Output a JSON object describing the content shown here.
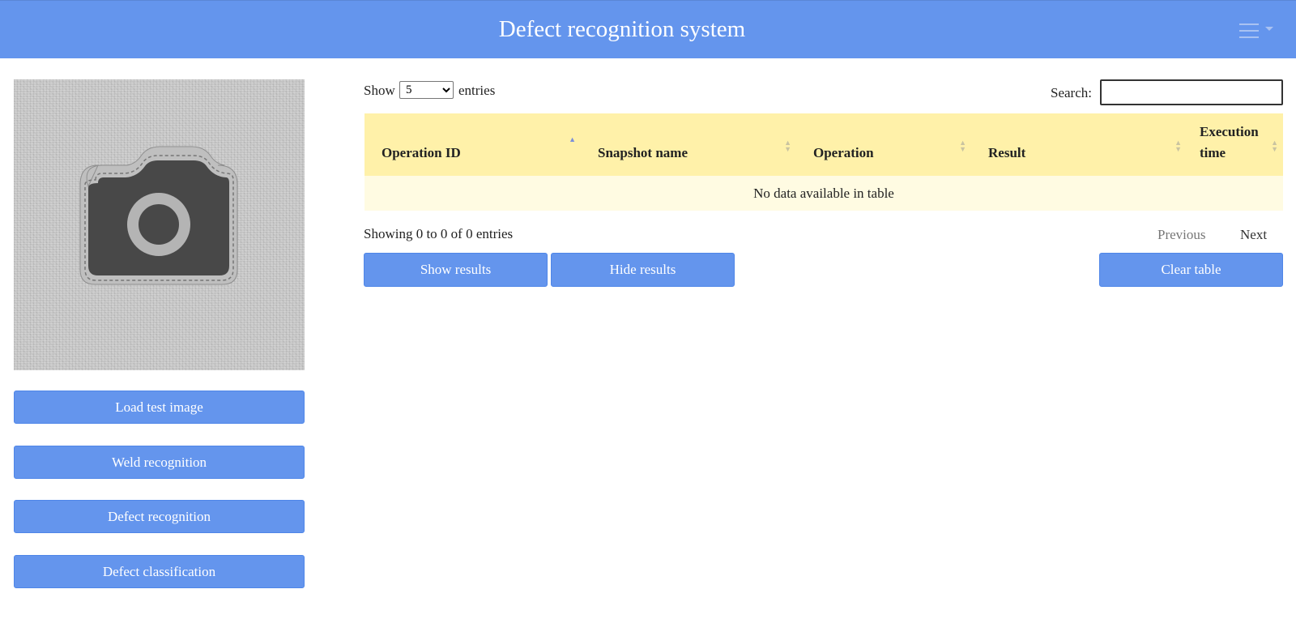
{
  "header": {
    "title": "Defect recognition system"
  },
  "snapshot": {
    "icon": "camera-icon"
  },
  "sidebar": {
    "buttons": [
      {
        "label": "Load test image"
      },
      {
        "label": "Weld recognition"
      },
      {
        "label": "Defect recognition"
      },
      {
        "label": "Defect classification"
      }
    ]
  },
  "table_controls": {
    "show_label": "Show",
    "entries_label": "entries",
    "length_selected": "5",
    "search_label": "Search:",
    "search_value": ""
  },
  "table": {
    "columns": [
      {
        "label": "Operation ID",
        "sort": "ascending"
      },
      {
        "label": "Snapshot name",
        "sort": "none"
      },
      {
        "label": "Operation",
        "sort": "none"
      },
      {
        "label": "Result",
        "sort": "none"
      },
      {
        "label": "Execution time",
        "sort": "none"
      }
    ],
    "empty_message": "No data available in table"
  },
  "pagination": {
    "info": "Showing 0 to 0 of 0 entries",
    "previous": "Previous",
    "next": "Next"
  },
  "actions": {
    "show_results": "Show results",
    "hide_results": "Hide results",
    "clear_table": "Clear table"
  },
  "colors": {
    "header_bg": "#6495ed",
    "button_bg": "#6495ed",
    "table_header_bg": "#fff1a9",
    "table_row_bg": "#fffbe2"
  }
}
